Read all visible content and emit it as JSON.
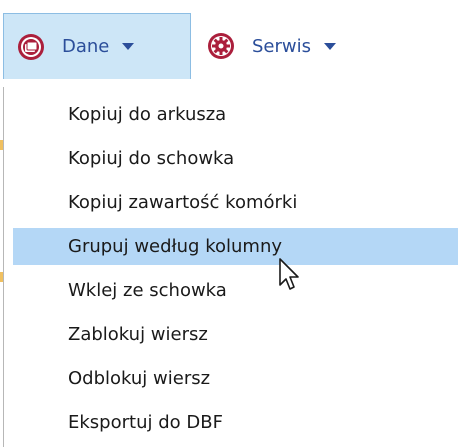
{
  "toolbar": {
    "dane": {
      "label": "Dane",
      "icon": "database-icon",
      "active": true
    },
    "serwis": {
      "label": "Serwis",
      "icon": "gear-icon",
      "active": false
    }
  },
  "menu": {
    "items": [
      {
        "label": "Kopiuj do arkusza"
      },
      {
        "label": "Kopiuj do schowka"
      },
      {
        "label": "Kopiuj zawartość komórki"
      },
      {
        "label": "Grupuj według kolumny",
        "highlighted": true
      },
      {
        "label": "Wklej ze schowka"
      },
      {
        "label": "Zablokuj wiersz"
      },
      {
        "label": "Odblokuj wiersz"
      },
      {
        "label": "Eksportuj do DBF"
      }
    ]
  },
  "colors": {
    "accent_text": "#2b4e9a",
    "active_button_bg": "#cde6f7",
    "highlight_bg": "#b4d7f6",
    "icon_fill": "#ab1f3c"
  }
}
